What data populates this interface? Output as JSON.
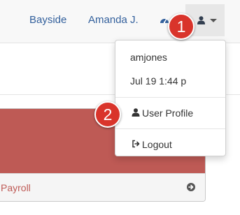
{
  "navbar": {
    "location_label": "Bayside",
    "user_label": "Amanda J.",
    "dashboard_icon": "tachometer-icon",
    "user_menu_icon": "user-icon"
  },
  "dropdown": {
    "username": "amjones",
    "timestamp": "Jul 19 1:44 p",
    "items": [
      {
        "label": "User Profile",
        "icon": "user-icon"
      },
      {
        "label": "Logout",
        "icon": "sign-out-icon"
      }
    ]
  },
  "panel": {
    "footer_label": "Payroll",
    "footer_icon": "arrow-circle-right-icon"
  },
  "callouts": [
    "1",
    "2"
  ],
  "colors": {
    "nav_link": "#33609c",
    "panel_heading": "#be5a55",
    "callout_badge": "#d9342b"
  }
}
